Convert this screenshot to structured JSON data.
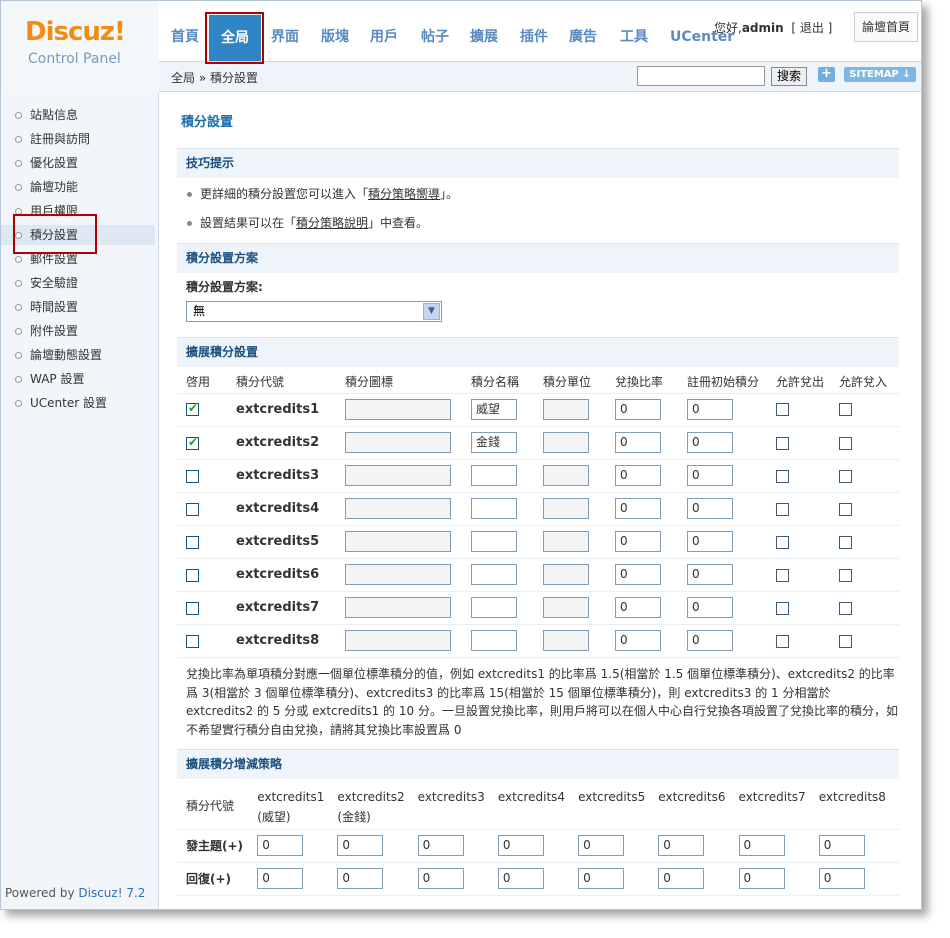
{
  "header": {
    "logo_title": "Discuz!",
    "logo_sub": "Control Panel",
    "tabs": [
      {
        "label": "首頁"
      },
      {
        "label": "全局"
      },
      {
        "label": "界面"
      },
      {
        "label": "版塊"
      },
      {
        "label": "用戶"
      },
      {
        "label": "帖子"
      },
      {
        "label": "擴展"
      },
      {
        "label": "插件"
      },
      {
        "label": "廣告"
      },
      {
        "label": "工具"
      },
      {
        "label": "UCenter"
      }
    ],
    "greeting_prefix": "您好,",
    "username": "admin",
    "logout": "[ 退出 ]",
    "home_button": "論壇首頁"
  },
  "subbar": {
    "breadcrumb": "全局 » 積分設置",
    "search_button": "搜索",
    "plus": "+",
    "sitemap": "SITEMAP ↓"
  },
  "sidebar": {
    "items": [
      {
        "label": "站點信息"
      },
      {
        "label": "註冊與訪問"
      },
      {
        "label": "優化設置"
      },
      {
        "label": "論壇功能"
      },
      {
        "label": "用戶權限"
      },
      {
        "label": "積分設置"
      },
      {
        "label": "郵件設置"
      },
      {
        "label": "安全驗證"
      },
      {
        "label": "時間設置"
      },
      {
        "label": "附件設置"
      },
      {
        "label": "論壇動態設置"
      },
      {
        "label": "WAP 設置"
      },
      {
        "label": "UCenter 設置"
      }
    ],
    "powered_prefix": "Powered by ",
    "powered_brand": "Discuz! 7.2"
  },
  "main": {
    "title": "積分設置",
    "tips_head": "技巧提示",
    "tip1_pre": "更詳細的積分設置您可以進入「",
    "tip1_link": "積分策略嚮導",
    "tip1_post": "」。",
    "tip2_pre": "設置結果可以在「",
    "tip2_link": "積分策略說明",
    "tip2_post": "」中查看。",
    "scheme_head": "積分設置方案",
    "scheme_label": "積分設置方案:",
    "scheme_value": "無",
    "ext_head": "擴展積分設置",
    "ext_columns": [
      "啓用",
      "積分代號",
      "積分圖標",
      "積分名稱",
      "積分單位",
      "兌換比率",
      "註冊初始積分",
      "允許兌出",
      "允許兌入"
    ],
    "ext_rows": [
      {
        "code": "extcredits1",
        "enabled": true,
        "name": "威望",
        "ratio": "0",
        "init": "0"
      },
      {
        "code": "extcredits2",
        "enabled": true,
        "name": "金錢",
        "ratio": "0",
        "init": "0"
      },
      {
        "code": "extcredits3",
        "enabled": false,
        "name": "",
        "ratio": "0",
        "init": "0"
      },
      {
        "code": "extcredits4",
        "enabled": false,
        "name": "",
        "ratio": "0",
        "init": "0"
      },
      {
        "code": "extcredits5",
        "enabled": false,
        "name": "",
        "ratio": "0",
        "init": "0"
      },
      {
        "code": "extcredits6",
        "enabled": false,
        "name": "",
        "ratio": "0",
        "init": "0"
      },
      {
        "code": "extcredits7",
        "enabled": false,
        "name": "",
        "ratio": "0",
        "init": "0"
      },
      {
        "code": "extcredits8",
        "enabled": false,
        "name": "",
        "ratio": "0",
        "init": "0"
      }
    ],
    "note": "兌換比率為單項積分對應一個單位標準積分的值，例如 extcredits1 的比率爲 1.5(相當於 1.5 個單位標準積分)、extcredits2 的比率爲 3(相當於 3 個單位標準積分)、extcredits3 的比率爲 15(相當於 15 個單位標準積分)，則 extcredits3 的 1 分相當於 extcredits2 的 5 分或 extcredits1 的 10 分。一旦設置兌換比率，則用戶將可以在個人中心自行兌換各項設置了兌換比率的積分，如不希望實行積分自由兌換，請將其兌換比率設置爲 0",
    "policy_head": "擴展積分增減策略",
    "policy_code_label": "積分代號",
    "policy_columns": [
      {
        "code": "extcredits1",
        "name": "(威望)"
      },
      {
        "code": "extcredits2",
        "name": "(金錢)"
      },
      {
        "code": "extcredits3",
        "name": ""
      },
      {
        "code": "extcredits4",
        "name": ""
      },
      {
        "code": "extcredits5",
        "name": ""
      },
      {
        "code": "extcredits6",
        "name": ""
      },
      {
        "code": "extcredits7",
        "name": ""
      },
      {
        "code": "extcredits8",
        "name": ""
      }
    ],
    "policy_rows": [
      {
        "label": "發主題(+)",
        "values": [
          "0",
          "0",
          "0",
          "0",
          "0",
          "0",
          "0",
          "0"
        ]
      },
      {
        "label": "回復(+)",
        "values": [
          "0",
          "0",
          "0",
          "0",
          "0",
          "0",
          "0",
          "0"
        ]
      }
    ]
  }
}
